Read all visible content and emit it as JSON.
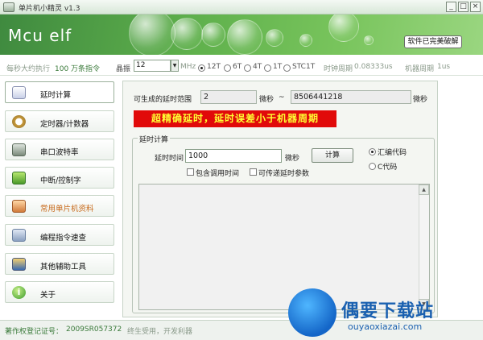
{
  "window": {
    "title": "单片机小精灵  v1.3",
    "minimize": "_",
    "restore": "□",
    "close": "×"
  },
  "banner": {
    "logo": "Mcu elf",
    "crack_button": "软件已完美破解"
  },
  "infobar": {
    "speed_prefix": "每秒大约执行",
    "speed_value": "100 万条指令",
    "crystal_label": "晶振",
    "crystal_value": "12",
    "crystal_unit": "MHz",
    "modes": [
      {
        "label": "12T",
        "selected": true
      },
      {
        "label": "6T",
        "selected": false
      },
      {
        "label": "4T",
        "selected": false
      },
      {
        "label": "1T",
        "selected": false
      },
      {
        "label": "STC1T",
        "selected": false,
        "highlight": true
      }
    ],
    "clock_label": "时钟周期",
    "clock_value": "0.08333us",
    "machine_label": "机器周期",
    "machine_value": "1us"
  },
  "sidebar": {
    "items": [
      {
        "label": "延时计算",
        "icon": "hand-pointer-icon",
        "active": true
      },
      {
        "label": "定时器/计数器",
        "icon": "stopwatch-icon"
      },
      {
        "label": "串口波特率",
        "icon": "serial-port-icon"
      },
      {
        "label": "中断/控制字",
        "icon": "chip-icon"
      },
      {
        "label": "常用单片机资料",
        "icon": "book-icon",
        "highlight": true
      },
      {
        "label": "编程指令速查",
        "icon": "keyboard-icon"
      },
      {
        "label": "其他辅助工具",
        "icon": "toolbox-icon"
      },
      {
        "label": "关于",
        "icon": "info-icon"
      }
    ]
  },
  "main": {
    "range_label": "可生成的延时范围",
    "range_min": "2",
    "range_unit_1": "微秒",
    "range_sep": "~",
    "range_max": "8506441218",
    "range_unit_2": "微秒",
    "warning": "超精确延时，延时误差小于机器周期",
    "group_title": "延时计算",
    "delay_label": "延时时间",
    "delay_value": "1000",
    "delay_unit": "微秒",
    "calc_button": "计算",
    "radio_asm": "汇编代码",
    "radio_c": "C代码",
    "check_call": "包含调用时间",
    "check_param": "可传递延时参数"
  },
  "statusbar": {
    "reg_label": "著作权登记证号：",
    "reg_value": "2009SR057372",
    "slogan": "终生受用，开发利器"
  },
  "watermark": {
    "title": "偶要下载站",
    "url": "ouyaoxiazai.com"
  }
}
